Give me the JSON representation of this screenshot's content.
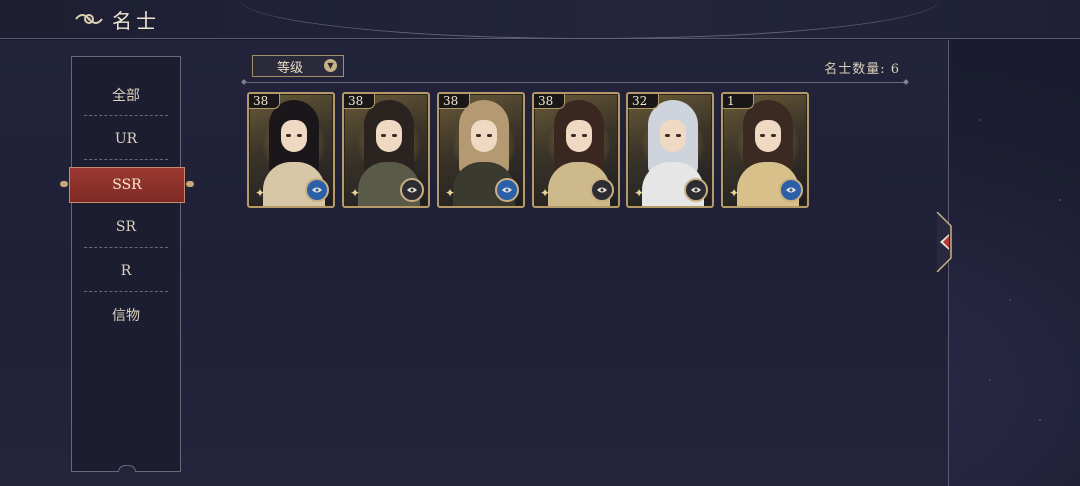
{
  "header": {
    "title": "名士"
  },
  "sidebar": {
    "items": [
      {
        "label": "全部"
      },
      {
        "label": "UR"
      },
      {
        "label": "SSR",
        "active": true
      },
      {
        "label": "SR"
      },
      {
        "label": "R"
      },
      {
        "label": "信物"
      }
    ]
  },
  "filter": {
    "label": "等级"
  },
  "count_label": "名士数量: 6",
  "cards": [
    {
      "level": "38",
      "hair": "#1b1619",
      "robe": "#d8c7a6",
      "badge": "blue"
    },
    {
      "level": "38",
      "hair": "#2a2320",
      "robe": "#5a5a48",
      "badge": "dark"
    },
    {
      "level": "38",
      "hair": "#b39a72",
      "robe": "#3a3a2e",
      "badge": "blue"
    },
    {
      "level": "38",
      "hair": "#3a2820",
      "robe": "#cdb98a",
      "badge": "dark"
    },
    {
      "level": "32",
      "hair": "#cfd3dc",
      "robe": "#e6e6e6",
      "badge": "dark"
    },
    {
      "level": "1",
      "hair": "#3a2a22",
      "robe": "#d8c08a",
      "badge": "blue"
    }
  ],
  "colors": {
    "active_tab": "#8b3129",
    "gold_border": "#b49a68",
    "badge_blue": "#2b5fa8",
    "badge_dark": "#2d2c33"
  }
}
